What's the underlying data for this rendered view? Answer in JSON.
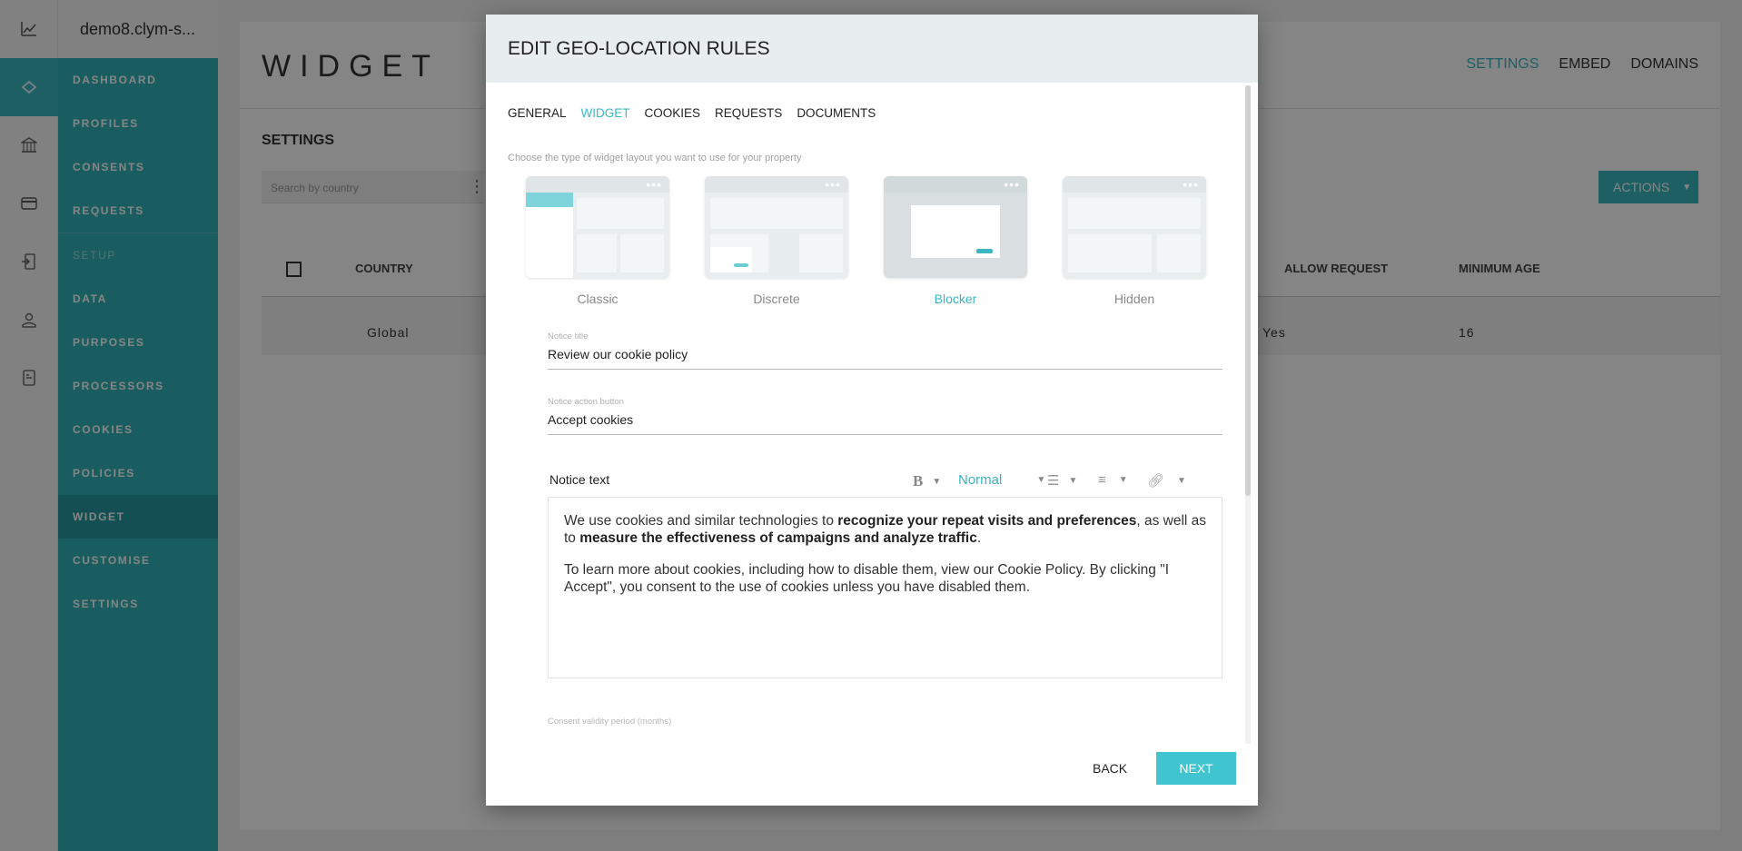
{
  "app": {
    "property_name": "demo8.clym-s..."
  },
  "rail": {
    "icons": [
      "chart-icon",
      "layers-icon",
      "bank-icon",
      "card-icon",
      "door-icon",
      "person-icon",
      "document-icon"
    ]
  },
  "nav": {
    "items": [
      {
        "label": "DASHBOARD"
      },
      {
        "label": "PROFILES"
      },
      {
        "label": "CONSENTS"
      },
      {
        "label": "REQUESTS"
      },
      {
        "label": "SETUP"
      },
      {
        "label": "DATA"
      },
      {
        "label": "PURPOSES"
      },
      {
        "label": "PROCESSORS"
      },
      {
        "label": "COOKIES"
      },
      {
        "label": "POLICIES"
      },
      {
        "label": "WIDGET"
      },
      {
        "label": "CUSTOMISE"
      },
      {
        "label": "SETTINGS"
      }
    ]
  },
  "header": {
    "title": "WIDGET",
    "tabs": [
      {
        "label": "SETTINGS"
      },
      {
        "label": "EMBED"
      },
      {
        "label": "DOMAINS"
      }
    ]
  },
  "settings": {
    "title": "SETTINGS",
    "search_placeholder": "Search by country",
    "actions_label": "ACTIONS",
    "columns": [
      "COUNTRY",
      "ALLOW REQUEST",
      "MINIMUM AGE"
    ],
    "row": {
      "country": "Global",
      "allow_request": "Yes",
      "minimum_age": "16"
    }
  },
  "dialog": {
    "title": "EDIT GEO-LOCATION RULES",
    "tabs": [
      {
        "label": "GENERAL"
      },
      {
        "label": "WIDGET"
      },
      {
        "label": "COOKIES"
      },
      {
        "label": "REQUESTS"
      },
      {
        "label": "DOCUMENTS"
      }
    ],
    "choose_text": "Choose the type of widget layout you want to use for your property",
    "layouts": [
      {
        "label": "Classic"
      },
      {
        "label": "Discrete"
      },
      {
        "label": "Blocker"
      },
      {
        "label": "Hidden"
      }
    ],
    "selected_layout": "Blocker",
    "notice_title": {
      "label": "Notice title",
      "value": "Review our cookie policy"
    },
    "notice_action": {
      "label": "Notice action button",
      "value": "Accept cookies"
    },
    "notice_text": {
      "label": "Notice text",
      "format": "Normal",
      "p1_a": "We use cookies and similar technologies to ",
      "p1_b": "recognize your repeat visits and preferences",
      "p1_c": ", as well as to ",
      "p1_d": "measure the effectiveness of campaigns and analyze traffic",
      "p1_e": ".",
      "p2": "To learn more about cookies, including how to disable them, view our Cookie Policy. By clicking \"I Accept\", you consent to the use of cookies unless you have disabled them."
    },
    "consent_label": "Consent validity period (months)",
    "back_label": "BACK",
    "next_label": "NEXT"
  },
  "colors": {
    "accent": "#3ab7c0",
    "nav_bg": "#33b3bb",
    "nav_active": "#2799a0",
    "next_button": "#40c4cf"
  }
}
